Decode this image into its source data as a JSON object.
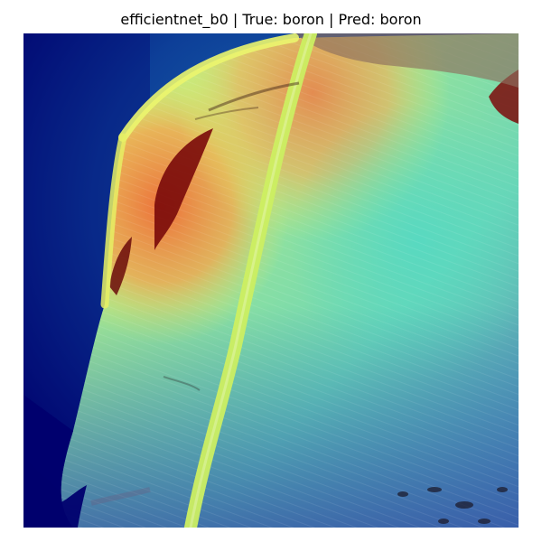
{
  "figure": {
    "title": "efficientnet_b0 | True: boron | Pred: boron",
    "image_subject": "leaf-gradcam-heatmap",
    "colormap_colors": {
      "background_low": "#00006e",
      "low": "#0a3fa0",
      "mid_low": "#2aa6c8",
      "mid": "#5fe0b0",
      "mid_high": "#e8f060",
      "high": "#f08040",
      "peak": "#a01010"
    }
  }
}
